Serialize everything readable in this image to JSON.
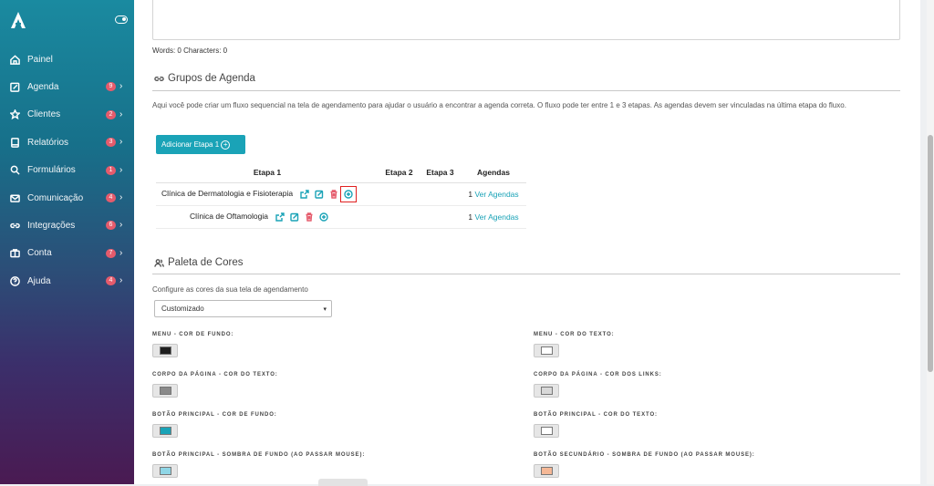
{
  "sidebar": {
    "items": [
      {
        "label": "Painel",
        "icon": "home-icon",
        "badge": ""
      },
      {
        "label": "Agenda",
        "icon": "calendar-edit-icon",
        "badge": "9"
      },
      {
        "label": "Clientes",
        "icon": "star-icon",
        "badge": "2"
      },
      {
        "label": "Relatórios",
        "icon": "book-icon",
        "badge": "3"
      },
      {
        "label": "Formulários",
        "icon": "search-icon",
        "badge": "1"
      },
      {
        "label": "Comunicação",
        "icon": "mail-icon",
        "badge": "4"
      },
      {
        "label": "Integrações",
        "icon": "link-icon",
        "badge": "6"
      },
      {
        "label": "Conta",
        "icon": "briefcase-icon",
        "badge": "7"
      },
      {
        "label": "Ajuda",
        "icon": "help-icon",
        "badge": "4"
      }
    ]
  },
  "editor": {
    "word_count": "Words: 0  Characters: 0"
  },
  "groups": {
    "title": "Grupos de Agenda",
    "description": "Aqui você pode criar um fluxo sequencial na tela de agendamento para ajudar o usuário a encontrar a agenda correta. O fluxo pode ter entre 1 e 3 etapas. As agendas devem ser vinculadas na última etapa do fluxo.",
    "add_button": "Adicionar Etapa 1",
    "columns": [
      "Etapa 1",
      "Etapa 2",
      "Etapa 3",
      "Agendas"
    ],
    "rows": [
      {
        "name": "Clínica de Dermatologia e Fisioterapia",
        "count": "1",
        "link": "Ver Agendas"
      },
      {
        "name": "Clínica de Oftamologia",
        "count": "1",
        "link": "Ver Agendas"
      }
    ]
  },
  "palette": {
    "title": "Paleta de Cores",
    "subtitle": "Configure as cores da sua tela de agendamento",
    "select_value": "Customizado",
    "fields": [
      {
        "label": "MENU - COR DE FUNDO:",
        "color": "#1e1e1e"
      },
      {
        "label": "MENU - COR DO TEXTO:",
        "color": "#ffffff"
      },
      {
        "label": "CORPO DA PÁGINA - COR DO TEXTO:",
        "color": "#8a8a8a"
      },
      {
        "label": "CORPO DA PÁGINA - COR DOS LINKS:",
        "color": "#d8d8d8"
      },
      {
        "label": "BOTÃO PRINCIPAL - COR DE FUNDO:",
        "color": "#1aa3b7"
      },
      {
        "label": "BOTÃO PRINCIPAL - COR DO TEXTO:",
        "color": "#ffffff"
      },
      {
        "label": "BOTÃO PRINCIPAL - SOMBRA DE FUNDO (AO PASSAR MOUSE):",
        "color": "#8fd6e6"
      },
      {
        "label": "BOTÃO SECUNDÁRIO - SOMBRA DE FUNDO (AO PASSAR MOUSE):",
        "color": "#f5b896"
      }
    ]
  },
  "colors": {
    "accent": "#1aa3b7",
    "badge": "#e55b6c",
    "highlight": "#e02020"
  }
}
